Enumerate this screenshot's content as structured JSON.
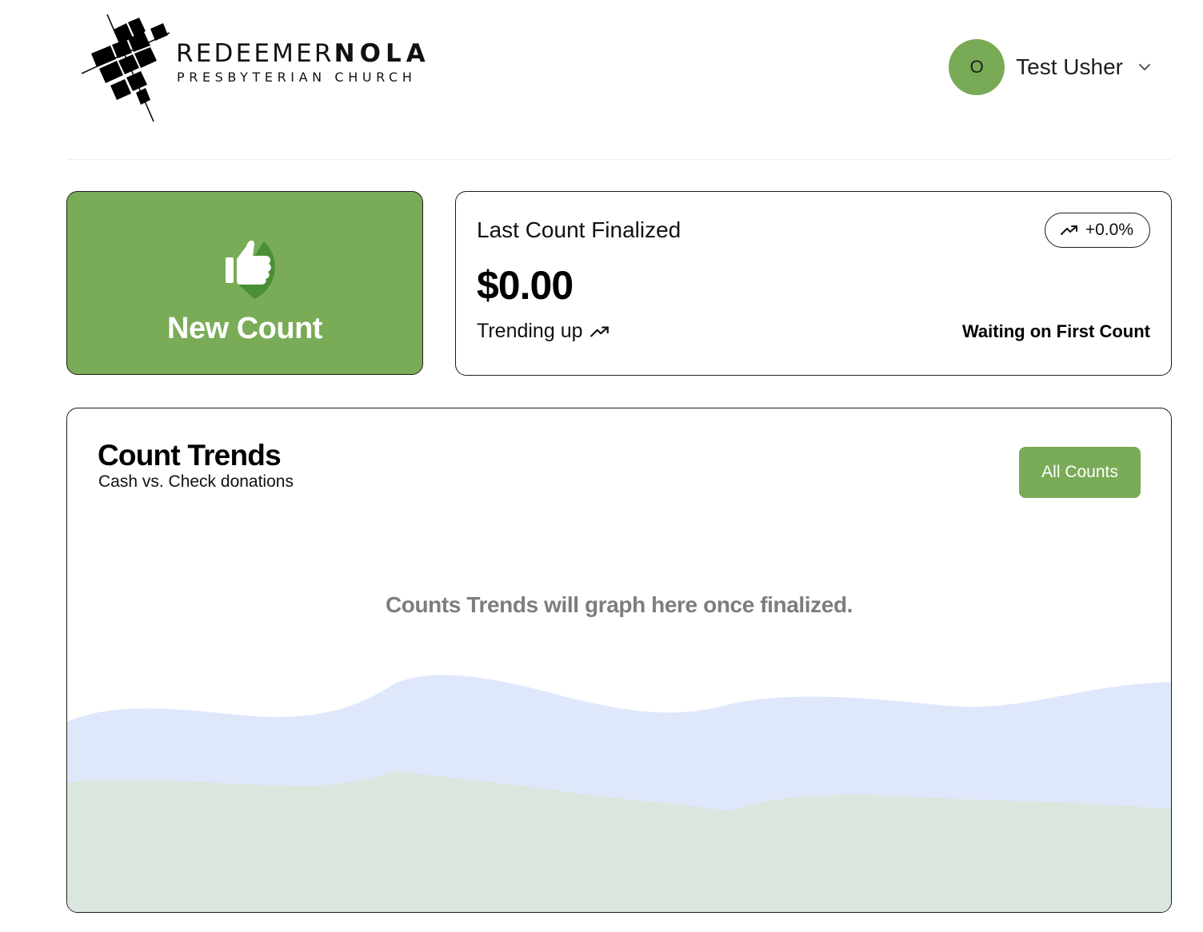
{
  "header": {
    "logo": {
      "word_light": "REDEEMER",
      "word_heavy": "NOLA",
      "subtitle": "PRESBYTERIAN CHURCH",
      "icon": "redeemer-nola-cross-logo"
    },
    "user": {
      "avatar_initial": "O",
      "name": "Test Usher",
      "menu_icon": "chevron-down-icon",
      "avatar_color": "#78aa56"
    }
  },
  "new_count_card": {
    "label": "New Count",
    "icon": "thumbs-up-icon",
    "background": "#7aab57"
  },
  "last_count_card": {
    "title": "Last Count Finalized",
    "change_badge": "+0.0%",
    "amount": "$0.00",
    "trend_label": "Trending up",
    "status": "Waiting on First Count"
  },
  "trends_card": {
    "title": "Count Trends",
    "subtitle": "Cash vs. Check donations",
    "all_counts_button": "All Counts",
    "placeholder": "Counts Trends will graph here once finalized.",
    "colors": {
      "check_area": "#dfe7fb",
      "cash_area": "#dbe6df"
    }
  }
}
